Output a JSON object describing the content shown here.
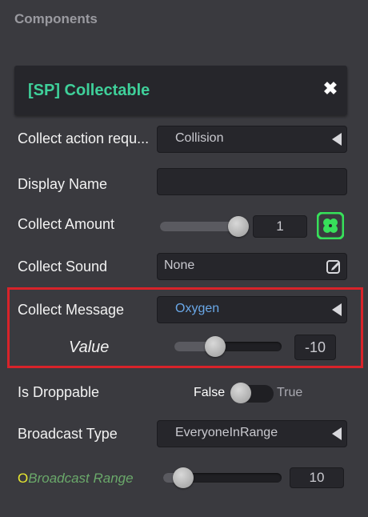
{
  "panel": {
    "title": "Components"
  },
  "component": {
    "title": "[SP] Collectable",
    "close_icon": "close-icon"
  },
  "rows": {
    "collect_action": {
      "label": "Collect action requ...",
      "value": "Collision"
    },
    "display_name": {
      "label": "Display Name",
      "value": ""
    },
    "collect_amount": {
      "label": "Collect Amount",
      "value": "1",
      "slider_fraction": 0.96,
      "icon": "clover-icon",
      "icon_color": "#37e05a"
    },
    "collect_sound": {
      "label": "Collect Sound",
      "value": "None",
      "icon": "edit-icon"
    },
    "collect_message": {
      "label": "Collect Message",
      "value": "Oxygen",
      "value_color": "#6aa8e8"
    },
    "value": {
      "label": "Value",
      "value": "-10",
      "slider_fraction": 0.35
    },
    "is_droppable": {
      "label": "Is Droppable",
      "false_label": "False",
      "true_label": "True",
      "state": false
    },
    "broadcast_type": {
      "label": "Broadcast Type",
      "value": "EveryoneInRange"
    },
    "broadcast_range": {
      "prefix": "O",
      "label": "Broadcast Range",
      "value": "10",
      "slider_fraction": 0.1,
      "label_color": "#6aa86a",
      "prefix_color": "#e8e830"
    }
  },
  "highlight_color": "#d8232a"
}
